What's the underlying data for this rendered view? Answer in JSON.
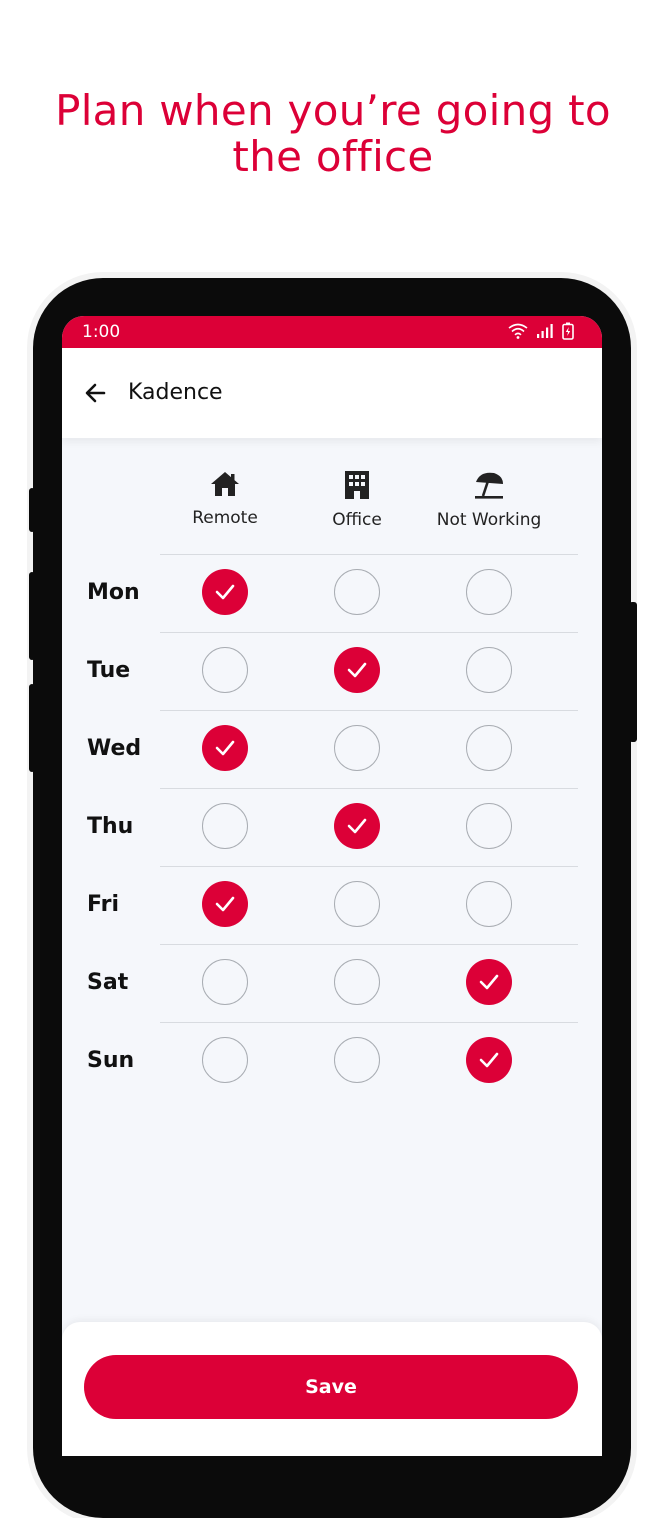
{
  "headline": {
    "line1": "Plan when you’re going to",
    "line2": "the office"
  },
  "status_bar": {
    "time": "1:00",
    "icons": [
      "wifi-icon",
      "signal-icon",
      "battery-icon"
    ]
  },
  "app_bar": {
    "title": "Kadence",
    "back_icon": "back-arrow-icon"
  },
  "columns": [
    {
      "label": "Remote",
      "icon": "home-icon"
    },
    {
      "label": "Office",
      "icon": "building-icon"
    },
    {
      "label": "Not Working",
      "icon": "beach-umbrella-icon"
    }
  ],
  "schedule": [
    {
      "day": "Mon",
      "selected": "Remote"
    },
    {
      "day": "Tue",
      "selected": "Office"
    },
    {
      "day": "Wed",
      "selected": "Remote"
    },
    {
      "day": "Thu",
      "selected": "Office"
    },
    {
      "day": "Fri",
      "selected": "Remote"
    },
    {
      "day": "Sat",
      "selected": "Not Working"
    },
    {
      "day": "Sun",
      "selected": "Not Working"
    }
  ],
  "save_label": "Save",
  "colors": {
    "accent": "#dc0037",
    "background": "#f5f7fb"
  }
}
